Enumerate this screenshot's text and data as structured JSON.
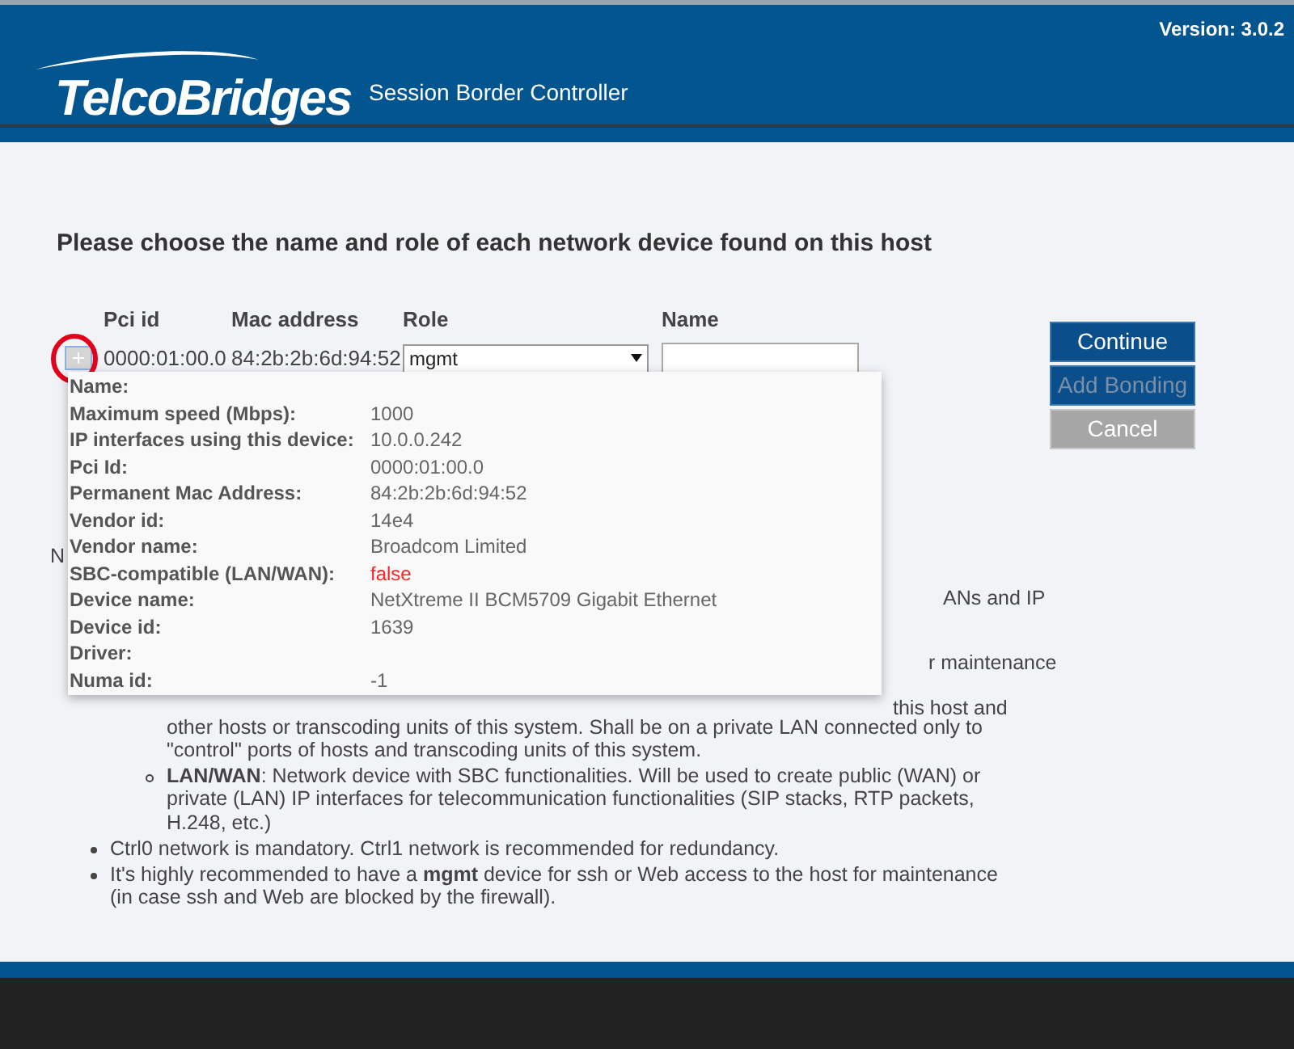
{
  "header": {
    "logo": "TelcoBridges",
    "product": "Session Border Controller",
    "version": "Version: 3.0.2"
  },
  "heading": "Please choose the name and role of each network device found on this host",
  "table": {
    "columns": [
      "Pci id",
      "Mac address",
      "Role",
      "Name"
    ],
    "rows": [
      {
        "expanded": true,
        "highlighted": true,
        "pci_id": "0000:01:00.0",
        "mac": "84:2b:2b:6d:94:52",
        "role": "mgmt"
      }
    ]
  },
  "details": [
    {
      "label": "Name:"
    },
    {
      "label": "Maximum speed (Mbps):",
      "value": "1000"
    },
    {
      "label": "IP interfaces using this device:",
      "value": "10.0.0.242"
    },
    {
      "label": "Pci Id:",
      "value": "0000:01:00.0"
    },
    {
      "label": "Permanent Mac Address:",
      "value": "84:2b:2b:6d:94:52"
    },
    {
      "label": "Vendor id:",
      "value": "14e4"
    },
    {
      "label": "Vendor name:",
      "value": "Broadcom Limited"
    },
    {
      "label": "SBC-compatible (LAN/WAN):",
      "value": "false",
      "alert": true
    },
    {
      "label": "Device name:",
      "value": "NetXtreme II BCM5709 Gigabit Ethernet"
    },
    {
      "label": "Device id:",
      "value": "1639"
    },
    {
      "label": "Driver:"
    },
    {
      "label": "Numa id:",
      "value": "-1"
    }
  ],
  "buttons": [
    {
      "label": "Continue",
      "disabled": false,
      "kind": "primary"
    },
    {
      "label": "Add Bonding",
      "disabled": true,
      "kind": "primary"
    },
    {
      "label": "Cancel",
      "disabled": false,
      "kind": "secondary"
    }
  ],
  "notes": {
    "fragments": [
      "N",
      "ANs and IP",
      "r maintenance",
      "this host and"
    ],
    "sub_item_rest": "other hosts or transcoding units of this system. Shall be on a private LAN connected only to \"control\" ports of hosts and transcoding units of this system.",
    "sub_items": [
      "**LAN/WAN**: Network device with SBC functionalities. Will be used to create public (WAN) or private (LAN) IP interfaces for telecommunication functionalities (SIP stacks, RTP packets, H.248, etc.)"
    ],
    "items": [
      "Ctrl0 network is mandatory. Ctrl1 network is recommended for redundancy.",
      "It's highly recommended to have a **mgmt** device for ssh or Web access to the host for maintenance (in case ssh and Web are blocked by the firewall)."
    ]
  }
}
